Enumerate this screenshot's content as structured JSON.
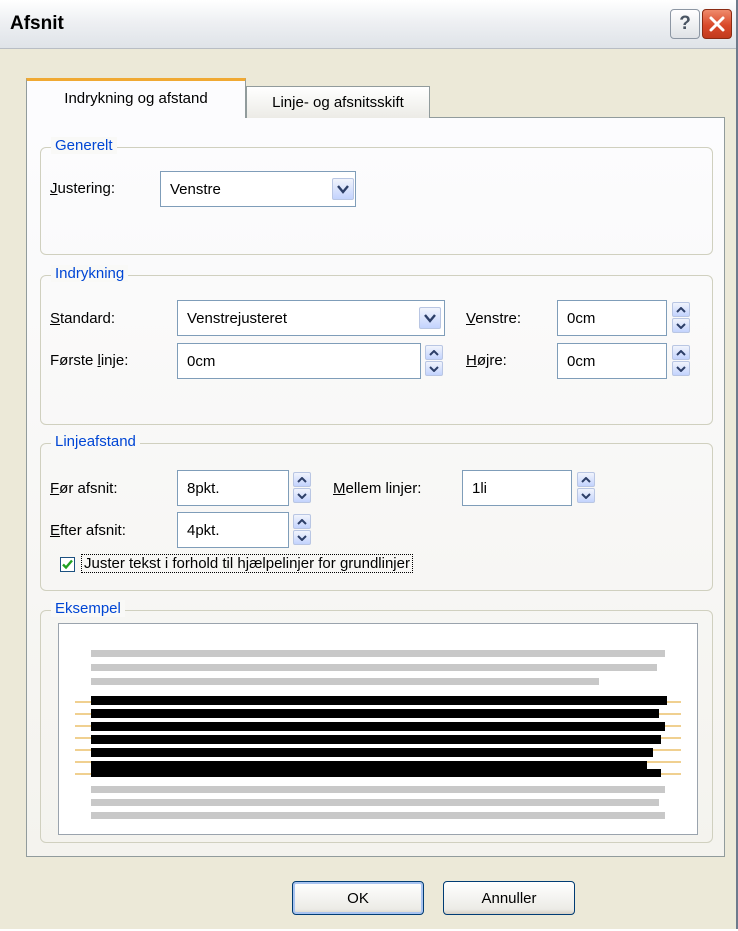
{
  "window": {
    "title": "Afsnit",
    "help_glyph": "?"
  },
  "tabs": [
    {
      "label": "Indrykning og afstand",
      "active": true
    },
    {
      "label": "Linje- og afsnitsskift",
      "active": false
    }
  ],
  "general": {
    "legend": "Generelt",
    "alignment_label": "Justering:",
    "alignment_value": "Venstre"
  },
  "indent": {
    "legend": "Indrykning",
    "standard_label": "Standard:",
    "standard_value": "Venstrejusteret",
    "first_line_label": "Første linje:",
    "first_line_value": "0cm",
    "left_label": "Venstre:",
    "left_value": "0cm",
    "right_label": "Højre:",
    "right_value": "0cm"
  },
  "spacing": {
    "legend": "Linjeafstand",
    "before_label": "Før afsnit:",
    "before_value": "8pkt.",
    "after_label": "Efter afsnit:",
    "after_value": "4pkt.",
    "between_label": "Mellem linjer:",
    "between_value": "1li",
    "grid_checkbox_label": "Juster tekst i forhold til hjælpelinjer for grundlinjer",
    "grid_checked": true
  },
  "preview": {
    "legend": "Eksempel"
  },
  "buttons": {
    "ok": "OK",
    "cancel": "Annuller"
  },
  "colors": {
    "legend_text": "#0046d5",
    "dialog_bg": "#ECE9D8",
    "tab_highlight": "#f0a933",
    "baseline_grid": "#e0a020"
  }
}
